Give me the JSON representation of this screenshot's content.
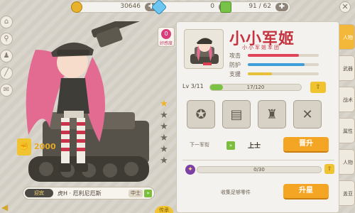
{
  "resources": {
    "gold": {
      "value": "30646",
      "icon": "coin-icon"
    },
    "diamond": {
      "value": "0",
      "icon": "diamond-icon"
    },
    "stamina": {
      "value": "91 / 62",
      "icon": "stamina-icon"
    },
    "plus": "✚"
  },
  "close_label": "✕",
  "favor": {
    "count": "0",
    "label": "好感度"
  },
  "power": {
    "value": "2000"
  },
  "character": {
    "tag": "迎宾",
    "name": "虎H · 厄利尼厄斯",
    "rank": "中士"
  },
  "pass_label": "传承",
  "logo": {
    "title": "小小军姬",
    "subtitle": "小小军姬军团"
  },
  "stats": [
    {
      "label": "攻击",
      "fill": 0.72,
      "color": "#e0455a"
    },
    {
      "label": "防护",
      "fill": 0.8,
      "color": "#3f9ed8"
    },
    {
      "label": "支援",
      "fill": 0.34,
      "color": "#e8c13a"
    }
  ],
  "level": {
    "label": "Lv 3/11",
    "xp": "17/120",
    "progress": 0.142
  },
  "rank_up": {
    "label": "下一军衔",
    "value": "上士",
    "button": "晋升"
  },
  "fragments": {
    "progress_text": "0/30",
    "progress": 0,
    "collect": "收集足够零件",
    "button": "升星"
  },
  "stars": {
    "total": 6,
    "lit": 1
  },
  "tabs": [
    "人物",
    "武器",
    "战术",
    "属性",
    "人物",
    "盖亚"
  ],
  "arrow_up": "⇧",
  "chevron": "»"
}
